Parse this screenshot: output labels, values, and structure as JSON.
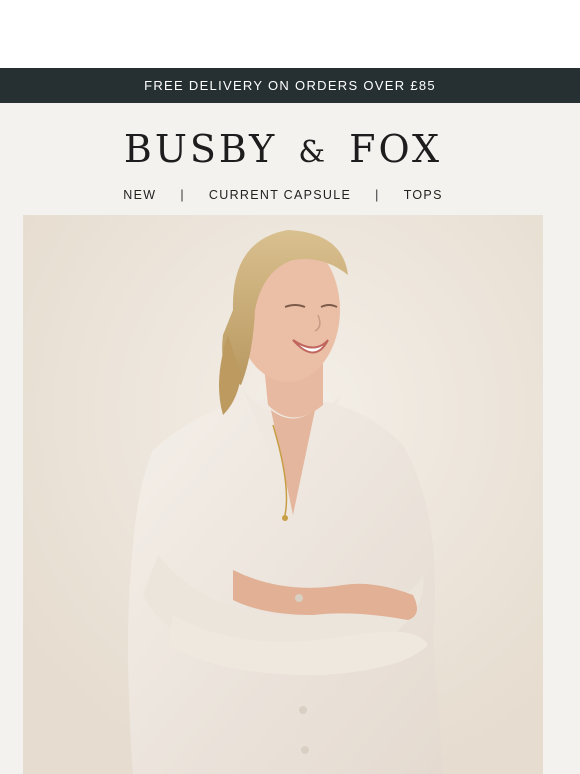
{
  "promo": {
    "text": "FREE DELIVERY ON ORDERS OVER £85"
  },
  "brand": {
    "left": "BUSBY",
    "amp": "&",
    "right": "FOX"
  },
  "nav": {
    "items": [
      {
        "label": "NEW"
      },
      {
        "label": "CURRENT CAPSULE"
      },
      {
        "label": "TOPS"
      }
    ],
    "separator": "|"
  },
  "colors": {
    "promo_bg": "#263032",
    "page_bg": "#f4f2ef",
    "text": "#1d1d1d"
  }
}
